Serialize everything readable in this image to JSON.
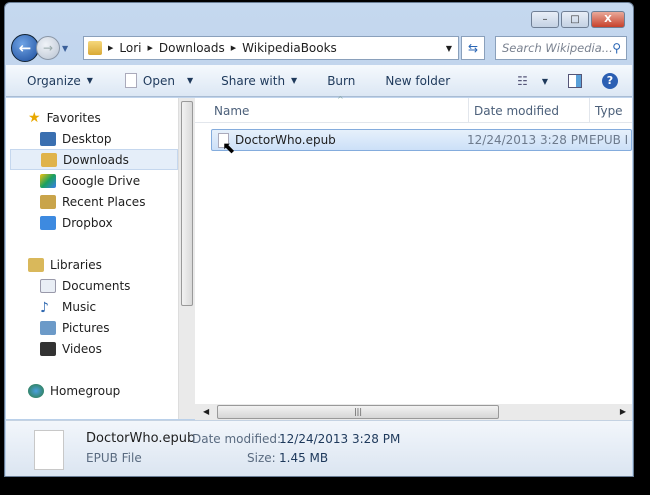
{
  "window": {
    "minimize": "–",
    "maximize": "□",
    "close": "X"
  },
  "address": {
    "crumbs": [
      "Lori",
      "Downloads",
      "WikipediaBooks"
    ]
  },
  "search": {
    "placeholder": "Search Wikipedia..."
  },
  "toolbar": {
    "organize": "Organize",
    "open": "Open",
    "share": "Share with",
    "burn": "Burn",
    "new_folder": "New folder"
  },
  "sidebar": {
    "favorites": "Favorites",
    "fav_items": [
      "Desktop",
      "Downloads",
      "Google Drive",
      "Recent Places",
      "Dropbox"
    ],
    "libraries": "Libraries",
    "lib_items": [
      "Documents",
      "Music",
      "Pictures",
      "Videos"
    ],
    "homegroup": "Homegroup"
  },
  "columns": {
    "name": "Name",
    "date": "Date modified",
    "type": "Type"
  },
  "files": [
    {
      "name": "DoctorWho.epub",
      "date": "12/24/2013 3:28 PM",
      "type": "EPUB I"
    }
  ],
  "details": {
    "name": "DoctorWho.epub",
    "date_label": "Date modified:",
    "date": "12/24/2013 3:28 PM",
    "type": "EPUB File",
    "size_label": "Size:",
    "size": "1.45 MB"
  }
}
